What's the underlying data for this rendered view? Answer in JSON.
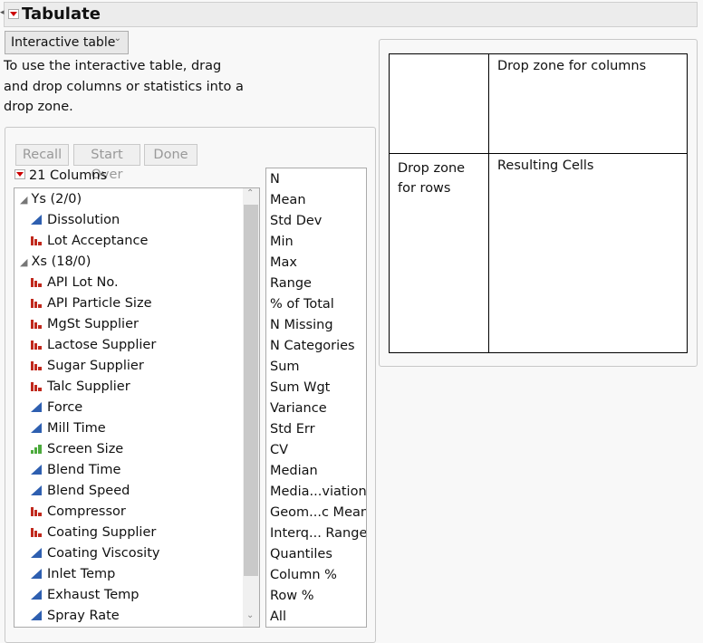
{
  "header": {
    "title": "Tabulate"
  },
  "mode_select": {
    "value": "Interactive table"
  },
  "instructions": "To use the interactive table, drag and drop columns or statistics into a drop zone.",
  "buttons": {
    "recall": "Recall",
    "start_over": "Start Over",
    "done": "Done"
  },
  "columns_header": "21 Columns",
  "columns": [
    {
      "label": "Ys (2/0)",
      "type": "group"
    },
    {
      "label": "Dissolution",
      "type": "continuous"
    },
    {
      "label": "Lot Acceptance",
      "type": "nominal"
    },
    {
      "label": "Xs (18/0)",
      "type": "group"
    },
    {
      "label": "API Lot No.",
      "type": "nominal"
    },
    {
      "label": "API Particle Size",
      "type": "nominal"
    },
    {
      "label": "MgSt Supplier",
      "type": "nominal"
    },
    {
      "label": "Lactose Supplier",
      "type": "nominal"
    },
    {
      "label": "Sugar Supplier",
      "type": "nominal"
    },
    {
      "label": "Talc Supplier",
      "type": "nominal"
    },
    {
      "label": "Force",
      "type": "continuous"
    },
    {
      "label": "Mill Time",
      "type": "continuous"
    },
    {
      "label": "Screen Size",
      "type": "ordinal"
    },
    {
      "label": "Blend Time",
      "type": "continuous"
    },
    {
      "label": "Blend Speed",
      "type": "continuous"
    },
    {
      "label": "Compressor",
      "type": "nominal"
    },
    {
      "label": "Coating Supplier",
      "type": "nominal"
    },
    {
      "label": "Coating Viscosity",
      "type": "continuous"
    },
    {
      "label": "Inlet Temp",
      "type": "continuous"
    },
    {
      "label": "Exhaust Temp",
      "type": "continuous"
    },
    {
      "label": "Spray Rate",
      "type": "continuous"
    }
  ],
  "statistics": [
    "N",
    "Mean",
    "Std Dev",
    "Min",
    "Max",
    "Range",
    "% of Total",
    "N Missing",
    "N Categories",
    "Sum",
    "Sum Wgt",
    "Variance",
    "Std Err",
    "CV",
    "Median",
    "Media...viation",
    "Geom...c Mean",
    "Interq... Range",
    "Quantiles",
    "Column %",
    "Row %",
    "All"
  ],
  "table": {
    "col_zone": "Drop zone for columns",
    "row_zone": "Drop zone for rows",
    "cells": "Resulting Cells"
  },
  "colors": {
    "continuous": "#2e5fb0",
    "nominal": "#c0281c",
    "ordinal": "#4caa3c"
  }
}
